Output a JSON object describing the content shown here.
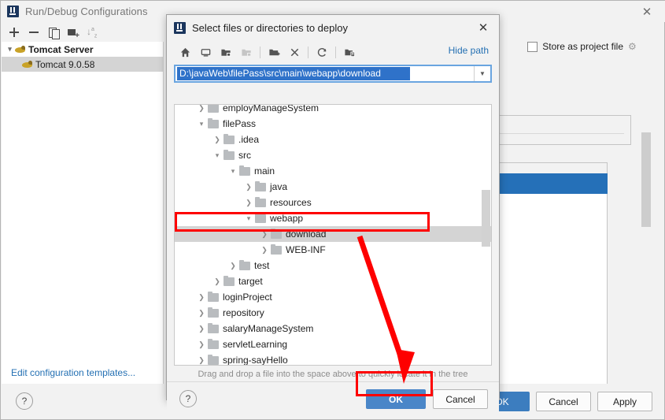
{
  "background_window": {
    "title": "Run/Debug Configurations",
    "logo_icon": "intellij-idea-logo",
    "close_icon": "✕",
    "toolbar": [
      {
        "name": "add-configuration",
        "icon": "plus-icon",
        "label": "+"
      },
      {
        "name": "remove-configuration",
        "icon": "minus-icon",
        "label": "−"
      },
      {
        "name": "copy-configuration",
        "icon": "copy-icon",
        "label": ""
      },
      {
        "name": "new-folder",
        "icon": "folder-plus-icon",
        "label": ""
      },
      {
        "name": "sort-configurations",
        "icon": "sort-az-icon",
        "label": "↓a z"
      }
    ],
    "tree": [
      {
        "label": "Tomcat Server",
        "icon": "tomcat-cat-icon",
        "expanded": true,
        "level": 0,
        "selected": false
      },
      {
        "label": "Tomcat 9.0.58",
        "icon": "tomcat-cat-icon",
        "expanded": null,
        "level": 1,
        "selected": true
      }
    ],
    "edit_templates_link": "Edit configuration templates...",
    "help_label": "?",
    "store_as_project_file": {
      "label": "Store as project file",
      "checked": false,
      "gear_icon": "gear-icon"
    },
    "buttons": [
      {
        "name": "ok-button",
        "label": "OK",
        "primary": true
      },
      {
        "name": "cancel-button",
        "label": "Cancel",
        "primary": false
      },
      {
        "name": "apply-button",
        "label": "Apply",
        "primary": false
      }
    ]
  },
  "dialog": {
    "title": "Select files or directories to deploy",
    "logo_icon": "intellij-idea-logo",
    "close_icon": "✕",
    "toolbar": [
      {
        "name": "home-icon",
        "glyph": "⌂",
        "disabled": false
      },
      {
        "name": "desktop-icon",
        "glyph": "▭",
        "disabled": false
      },
      {
        "name": "expand-folder-icon",
        "glyph": "▰",
        "disabled": false
      },
      {
        "name": "collapse-folder-icon",
        "glyph": "▰",
        "disabled": true
      },
      {
        "name": "new-folder-icon",
        "glyph": "▰",
        "disabled": false
      },
      {
        "name": "delete-icon",
        "glyph": "✕",
        "disabled": false
      },
      {
        "name": "refresh-icon",
        "glyph": "↺",
        "disabled": false
      },
      {
        "name": "show-hidden-files-icon",
        "glyph": "◔",
        "disabled": false
      }
    ],
    "hide_path_label": "Hide path",
    "path_field": {
      "value": "D:\\javaWeb\\filePass\\src\\main\\webapp\\download",
      "placeholder": "",
      "text_selected": true,
      "dropdown_icon": "chevron-down-icon"
    },
    "tree": [
      {
        "label": "employManageSystem",
        "level": 1,
        "expanded": false,
        "selected": false
      },
      {
        "label": "filePass",
        "level": 1,
        "expanded": true,
        "selected": false
      },
      {
        "label": ".idea",
        "level": 2,
        "expanded": false,
        "selected": false
      },
      {
        "label": "src",
        "level": 2,
        "expanded": true,
        "selected": false
      },
      {
        "label": "main",
        "level": 3,
        "expanded": true,
        "selected": false
      },
      {
        "label": "java",
        "level": 4,
        "expanded": false,
        "selected": false
      },
      {
        "label": "resources",
        "level": 4,
        "expanded": false,
        "selected": false
      },
      {
        "label": "webapp",
        "level": 4,
        "expanded": true,
        "selected": false
      },
      {
        "label": "download",
        "level": 5,
        "expanded": false,
        "selected": true
      },
      {
        "label": "WEB-INF",
        "level": 5,
        "expanded": false,
        "selected": false
      },
      {
        "label": "test",
        "level": 3,
        "expanded": false,
        "selected": false
      },
      {
        "label": "target",
        "level": 2,
        "expanded": false,
        "selected": false
      },
      {
        "label": "loginProject",
        "level": 1,
        "expanded": false,
        "selected": false
      },
      {
        "label": "repository",
        "level": 1,
        "expanded": false,
        "selected": false
      },
      {
        "label": "salaryManageSystem",
        "level": 1,
        "expanded": false,
        "selected": false
      },
      {
        "label": "servletLearning",
        "level": 1,
        "expanded": false,
        "selected": false
      },
      {
        "label": "spring-sayHello",
        "level": 1,
        "expanded": false,
        "selected": false
      }
    ],
    "hint": "Drag and drop a file into the space above to quickly locate it in the tree",
    "help_label": "?",
    "ok_label": "OK",
    "cancel_label": "Cancel"
  },
  "annotations": {
    "highlight_color": "#fe0000",
    "download_row_box": "download",
    "ok_button_box": "OK",
    "arrow": "arrow-from-download-to-ok"
  },
  "colors": {
    "accent_blue": "#2570b8",
    "ok_button_blue": "#4a86c8",
    "selection_gray": "#d4d4d4",
    "path_selection_blue": "#2f72c9",
    "link_blue": "#2470b3",
    "annotation_red": "#fe0000"
  }
}
